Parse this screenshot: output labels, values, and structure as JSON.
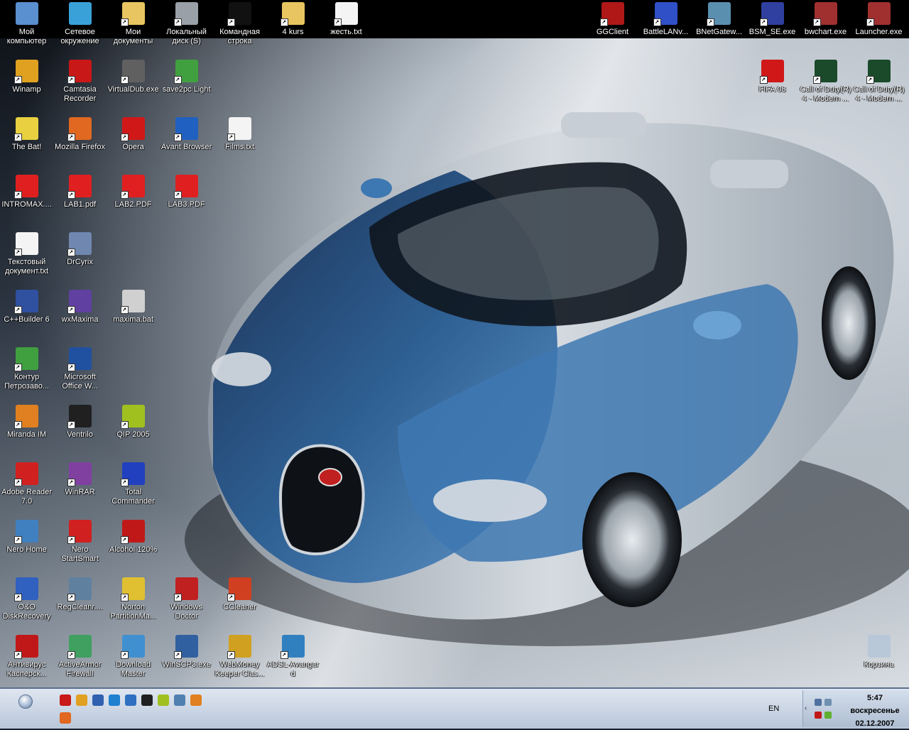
{
  "desktop": {
    "icons": [
      {
        "label": "Мой\nкомпьютер",
        "icon": "computer-icon",
        "color": "#5a8fd0"
      },
      {
        "label": "Сетевое\nокружение",
        "icon": "network-icon",
        "color": "#3aa0d8"
      },
      {
        "label": "Мои\nдокументы",
        "icon": "folder-icon",
        "color": "#e8c560"
      },
      {
        "label": "Локальный\nдиск (S)",
        "icon": "drive-icon",
        "color": "#9aa0a8"
      },
      {
        "label": "Командная\nстрока",
        "icon": "console-icon",
        "color": "#111111"
      },
      {
        "label": "4 kurs",
        "icon": "folder-icon",
        "color": "#e8c560"
      },
      {
        "label": "жесть.txt",
        "icon": "text-file-icon",
        "color": "#f4f4f4"
      },
      {
        "label": "GGClient",
        "icon": "gg-icon",
        "color": "#b01818"
      },
      {
        "label": "BattleLANv...",
        "icon": "battlelan-icon",
        "color": "#3050c8"
      },
      {
        "label": "BNetGatew...",
        "icon": "bnet-icon",
        "color": "#5a8fb0"
      },
      {
        "label": "BSM_SE.exe",
        "icon": "eye-icon",
        "color": "#3040a0"
      },
      {
        "label": "bwchart.exe",
        "icon": "bwchart-icon",
        "color": "#a03030"
      },
      {
        "label": "Launcher.exe",
        "icon": "launcher-icon",
        "color": "#a03030"
      },
      {
        "label": "Winamp",
        "icon": "winamp-icon",
        "color": "#e0a020"
      },
      {
        "label": "Camtasia\nRecorder",
        "icon": "camtasia-icon",
        "color": "#c81818"
      },
      {
        "label": "VirtualDub.exe",
        "icon": "virtualdub-icon",
        "color": "#606060"
      },
      {
        "label": "save2pc Light",
        "icon": "save2pc-icon",
        "color": "#40a040"
      },
      {
        "label": "FIFA 08",
        "icon": "fifa-icon",
        "color": "#d01818"
      },
      {
        "label": "Call of Duty(R)\n4 - Modern ...",
        "icon": "cod-icon",
        "color": "#1a4a2a"
      },
      {
        "label": "Call of Duty(R)\n4 - Modern ...",
        "icon": "cod-icon",
        "color": "#1a4a2a"
      },
      {
        "label": "The Bat!",
        "icon": "thebat-icon",
        "color": "#e8d040"
      },
      {
        "label": "Mozilla Firefox",
        "icon": "firefox-icon",
        "color": "#e06820"
      },
      {
        "label": "Opera",
        "icon": "opera-icon",
        "color": "#d01818"
      },
      {
        "label": "Avant Browser",
        "icon": "avant-icon",
        "color": "#2060c0"
      },
      {
        "label": "Films.txt",
        "icon": "text-file-icon",
        "color": "#f4f4f4"
      },
      {
        "label": "INTROMAX....",
        "icon": "pdf-icon",
        "color": "#e02020"
      },
      {
        "label": "LAB1.pdf",
        "icon": "pdf-icon",
        "color": "#e02020"
      },
      {
        "label": "LAB2.PDF",
        "icon": "pdf-icon",
        "color": "#e02020"
      },
      {
        "label": "LAB3.PDF",
        "icon": "pdf-icon",
        "color": "#e02020"
      },
      {
        "label": "Текстовый\nдокумент.txt",
        "icon": "text-file-icon",
        "color": "#f4f4f4"
      },
      {
        "label": "DrCyrix",
        "icon": "drcyrix-icon",
        "color": "#7088b0"
      },
      {
        "label": "C++Builder 6",
        "icon": "cppbuilder-icon",
        "color": "#3050a0"
      },
      {
        "label": "wxMaxima",
        "icon": "wxmaxima-icon",
        "color": "#6040a0"
      },
      {
        "label": "maxima.bat",
        "icon": "bat-file-icon",
        "color": "#d0d0d0"
      },
      {
        "label": "Контур\nПетрозаво...",
        "icon": "kontur-icon",
        "color": "#40a040"
      },
      {
        "label": "Microsoft\nOffice W...",
        "icon": "word-icon",
        "color": "#2050a0"
      },
      {
        "label": "Miranda IM",
        "icon": "miranda-icon",
        "color": "#e08020"
      },
      {
        "label": "Ventrilo",
        "icon": "ventrilo-icon",
        "color": "#202020"
      },
      {
        "label": "QIP 2005",
        "icon": "qip-icon",
        "color": "#a0c020"
      },
      {
        "label": "Adobe Reader\n7.0",
        "icon": "adobe-reader-icon",
        "color": "#d02020"
      },
      {
        "label": "WinRAR",
        "icon": "winrar-icon",
        "color": "#8040a0"
      },
      {
        "label": "Total\nCommander",
        "icon": "floppy-icon",
        "color": "#2040c0"
      },
      {
        "label": "Nero Home",
        "icon": "nero-home-icon",
        "color": "#4080c0"
      },
      {
        "label": "Nero\nStartSmart",
        "icon": "nero-icon",
        "color": "#d02020"
      },
      {
        "label": "Alcohol 120%",
        "icon": "alcohol-icon",
        "color": "#c01818"
      },
      {
        "label": "O&O\nDiskRecovery",
        "icon": "disk-recovery-icon",
        "color": "#3060c0"
      },
      {
        "label": "RegCleanr....",
        "icon": "regcleaner-icon",
        "color": "#6080a0"
      },
      {
        "label": "Norton\nPartitionMa...",
        "icon": "norton-icon",
        "color": "#e0c030"
      },
      {
        "label": "Windows\nDoctor",
        "icon": "shield-icon",
        "color": "#c02020"
      },
      {
        "label": "CCleaner",
        "icon": "ccleaner-icon",
        "color": "#d04020"
      },
      {
        "label": "Антивирус\nКасперск...",
        "icon": "kaspersky-icon",
        "color": "#c01818"
      },
      {
        "label": "ActiveArmor\nFirewall",
        "icon": "firewall-icon",
        "color": "#40a060"
      },
      {
        "label": "Download\nMaster",
        "icon": "download-icon",
        "color": "#4090d0"
      },
      {
        "label": "WinSCP3.exe",
        "icon": "winscp-icon",
        "color": "#3060a0"
      },
      {
        "label": "WebMoney\nKeeper Clas...",
        "icon": "webmoney-icon",
        "color": "#d0a020"
      },
      {
        "label": "ADSL-Avangar\nd",
        "icon": "adsl-icon",
        "color": "#3080c0"
      },
      {
        "label": "Корзина",
        "icon": "recycle-bin-icon",
        "color": "#b8c8d8"
      }
    ]
  },
  "taskbar": {
    "quick_launch": [
      {
        "icon": "camtasia-icon",
        "color": "#c81818"
      },
      {
        "icon": "winamp-icon",
        "color": "#e0a020"
      },
      {
        "icon": "media-player-icon",
        "color": "#3060b0"
      },
      {
        "icon": "ie-icon",
        "color": "#2080d0"
      },
      {
        "icon": "outlook-icon",
        "color": "#3070c0"
      },
      {
        "icon": "thebat-icon",
        "color": "#202020"
      },
      {
        "icon": "qip-icon",
        "color": "#a0c020"
      },
      {
        "icon": "network-icon",
        "color": "#5080b0"
      },
      {
        "icon": "miranda-icon",
        "color": "#e08020"
      },
      {
        "icon": "firefox-icon",
        "color": "#e06820"
      }
    ],
    "language": "EN",
    "tray_arrow": "‹",
    "clock": {
      "time": "5:47",
      "day": "воскресенье",
      "date": "02.12.2007"
    }
  }
}
